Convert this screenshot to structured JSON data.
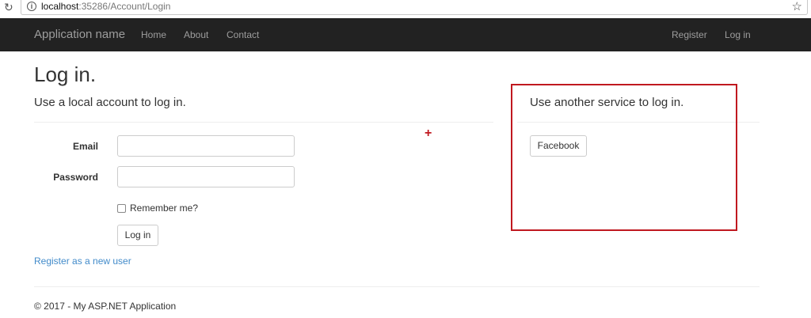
{
  "browser": {
    "url_host": "localhost",
    "url_path": ":35286/Account/Login",
    "reload_icon": "reload-icon",
    "info_icon": "info-icon",
    "bookmark_icon": "star-icon"
  },
  "navbar": {
    "brand": "Application name",
    "left_links": [
      "Home",
      "About",
      "Contact"
    ],
    "right_links": [
      "Register",
      "Log in"
    ]
  },
  "main": {
    "title": "Log in.",
    "local_heading": "Use a local account to log in.",
    "email_label": "Email",
    "password_label": "Password",
    "email_value": "",
    "password_value": "",
    "remember_label": "Remember me?",
    "remember_checked": false,
    "login_button": "Log in",
    "register_link": "Register as a new user"
  },
  "external": {
    "heading": "Use another service to log in.",
    "providers": [
      "Facebook"
    ]
  },
  "annotations": {
    "plus_marker": "+",
    "highlight_color": "#c0181f"
  },
  "footer": {
    "text": "© 2017 - My ASP.NET Application"
  }
}
